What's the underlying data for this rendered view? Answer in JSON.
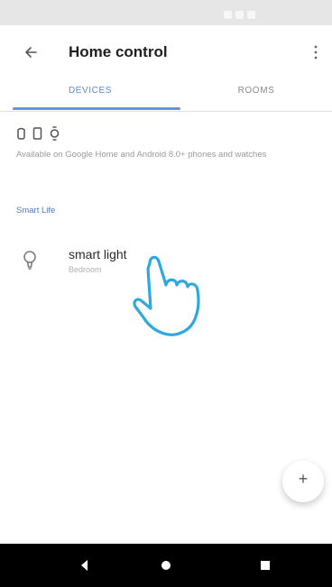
{
  "app_bar": {
    "title": "Home control"
  },
  "tabs": [
    {
      "label": "DEVICES",
      "selected": true
    },
    {
      "label": "ROOMS",
      "selected": false
    }
  ],
  "availability_text": "Available on Google Home and Android 8.0+ phones and watches",
  "section_title": "Smart Life",
  "device": {
    "name": "smart light",
    "room": "Bedroom"
  },
  "fab": {
    "label": "+"
  },
  "icons": {
    "back": "arrow-back-icon",
    "overflow": "more-vert-icon",
    "device_types": [
      "speaker-icon",
      "phone-icon",
      "watch-icon"
    ],
    "device": "lightbulb-icon",
    "nav": [
      "nav-back-icon",
      "nav-home-icon",
      "nav-recent-icon"
    ]
  },
  "colors": {
    "accent": "#5c86d6",
    "hand_outline": "#2ea8e0",
    "nav_bar": "#000000"
  }
}
